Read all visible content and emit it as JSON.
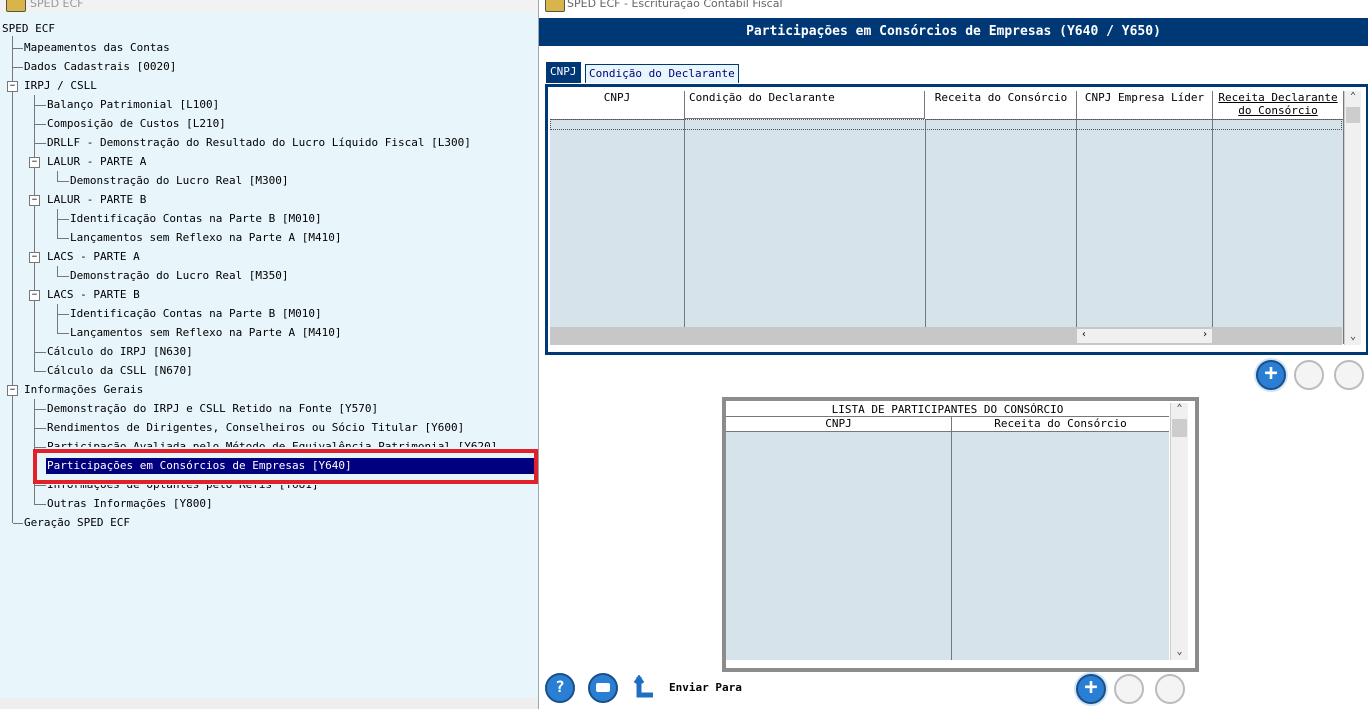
{
  "left_window": {
    "title": "SPED ECF",
    "tree": [
      {
        "label": "SPED ECF"
      },
      {
        "label": "Mapeamentos das Contas"
      },
      {
        "label": "Dados Cadastrais [0020]"
      },
      {
        "label": "IRPJ / CSLL"
      },
      {
        "label": "Balanço Patrimonial [L100]"
      },
      {
        "label": "Composição de Custos [L210]"
      },
      {
        "label": "DRLLF - Demonstração do Resultado do Lucro Líquido Fiscal [L300]"
      },
      {
        "label": "LALUR - PARTE A"
      },
      {
        "label": "Demonstração do Lucro Real [M300]"
      },
      {
        "label": "LALUR - PARTE B"
      },
      {
        "label": "Identificação Contas na Parte B [M010]"
      },
      {
        "label": "Lançamentos sem Reflexo na Parte A [M410]"
      },
      {
        "label": "LACS - PARTE A"
      },
      {
        "label": "Demonstração do Lucro Real [M350]"
      },
      {
        "label": "LACS - PARTE B"
      },
      {
        "label": "Identificação Contas na Parte B [M010]"
      },
      {
        "label": "Lançamentos sem Reflexo na Parte A [M410]"
      },
      {
        "label": "Cálculo do IRPJ [N630]"
      },
      {
        "label": "Cálculo da CSLL [N670]"
      },
      {
        "label": "Informações Gerais"
      },
      {
        "label": "Demonstração do IRPJ e CSLL Retido na Fonte [Y570]"
      },
      {
        "label": "Rendimentos de Dirigentes, Conselheiros ou Sócio Titular [Y600]"
      },
      {
        "label": "Participação Avaliada pelo Método de Equivalência Patrimonial [Y620]"
      },
      {
        "label": "Participações em Consórcios de Empresas [Y640]"
      },
      {
        "label": "Informações de Optantes pelo Refis [Y681]"
      },
      {
        "label": "Outras Informações [Y800]"
      },
      {
        "label": "Geração SPED ECF"
      }
    ],
    "selected_index": 23
  },
  "right_window": {
    "title": "SPED ECF - Escrituração Contábil Fiscal",
    "header": "Participações em Consórcios de Empresas (Y640 / Y650)",
    "tabs": [
      {
        "label": "CNPJ"
      },
      {
        "label": "Condição do Declarante"
      }
    ],
    "grid1": {
      "columns": [
        "CNPJ",
        "Condição do Declarante",
        "Receita do Consórcio",
        "CNPJ Empresa Líder",
        "Receita Declarante do Consórcio"
      ]
    },
    "grid2": {
      "title": "LISTA DE PARTICIPANTES DO CONSÓRCIO",
      "columns": [
        "CNPJ",
        "Receita do Consórcio"
      ]
    },
    "footer": {
      "send_label": "Enviar Para",
      "help_symbol": "?"
    },
    "add_symbol": "+"
  },
  "colors": {
    "header_bg": "#003876",
    "selection_bg": "#00007f",
    "highlight_border": "#e0202a",
    "grid_bg": "#d7e3ea"
  }
}
